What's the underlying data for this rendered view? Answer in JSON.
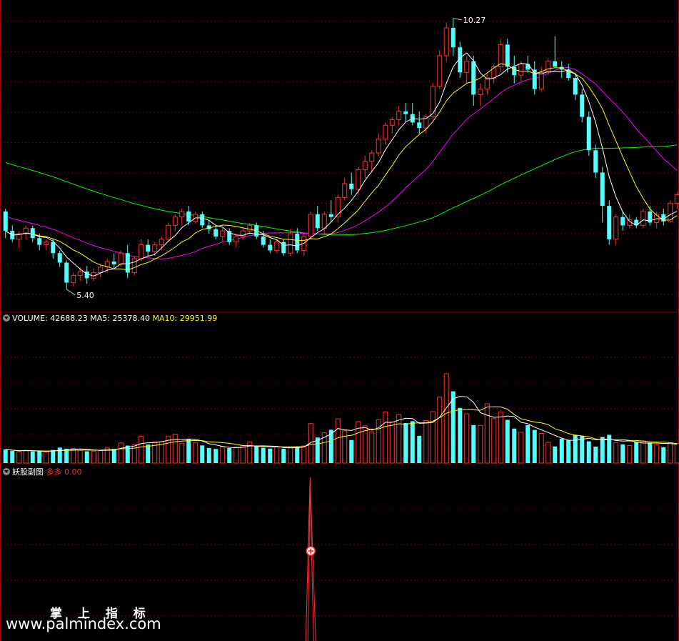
{
  "volume_header": {
    "name": "VOLUME:",
    "value": "42688.23",
    "ma5_label": "MA5:",
    "ma5_value": "25378.40",
    "ma10_label": "MA10:",
    "ma10_value": "29951.99"
  },
  "indicator_header": {
    "name": "妖股副图",
    "series_label": "多多",
    "series_value": "0.00"
  },
  "watermark": {
    "title": "掌 上 指 标",
    "url": "www.palmindex.com"
  },
  "colors": {
    "background": "#000000",
    "up": "#ff3232",
    "down": "#54ffff",
    "ma5": "#ffffff",
    "ma10": "#ffff00",
    "ma20": "#ff00ff",
    "ma60": "#00ff00",
    "grid": "#6e0000",
    "separator": "#a00000",
    "volume_header": "#ffffff",
    "volume_ma5": "#ffffff",
    "volume_ma10": "#ffff00",
    "indicator_label": "#ff3232"
  },
  "chart_data": [
    {
      "type": "candlestick",
      "panel": "price",
      "annotations": [
        {
          "text": "10.27",
          "kind": "high",
          "index": 66
        },
        {
          "text": "5.40",
          "kind": "low",
          "index": 9
        }
      ],
      "ylim": [
        5.0,
        10.55
      ],
      "moving_averages": [
        "MA5",
        "MA10",
        "MA20",
        "MA60"
      ],
      "candles": [
        [
          6.8,
          6.85,
          6.32,
          6.45
        ],
        [
          6.45,
          6.55,
          6.25,
          6.3
        ],
        [
          6.3,
          6.45,
          6.15,
          6.4
        ],
        [
          6.4,
          6.55,
          6.3,
          6.5
        ],
        [
          6.5,
          6.55,
          6.25,
          6.32
        ],
        [
          6.32,
          6.4,
          6.1,
          6.2
        ],
        [
          6.2,
          6.3,
          6.1,
          6.25
        ],
        [
          6.25,
          6.3,
          5.95,
          6.05
        ],
        [
          6.05,
          6.1,
          5.8,
          5.88
        ],
        [
          5.88,
          5.92,
          5.4,
          5.52
        ],
        [
          5.52,
          5.7,
          5.45,
          5.65
        ],
        [
          5.65,
          5.8,
          5.55,
          5.72
        ],
        [
          5.72,
          5.82,
          5.5,
          5.6
        ],
        [
          5.6,
          5.78,
          5.55,
          5.7
        ],
        [
          5.7,
          5.85,
          5.62,
          5.8
        ],
        [
          5.8,
          5.95,
          5.7,
          5.9
        ],
        [
          5.9,
          6.05,
          5.78,
          5.85
        ],
        [
          5.85,
          6.1,
          5.8,
          6.05
        ],
        [
          6.05,
          6.2,
          5.6,
          5.7
        ],
        [
          5.7,
          6.0,
          5.65,
          5.95
        ],
        [
          5.95,
          6.3,
          5.9,
          6.2
        ],
        [
          6.2,
          6.3,
          6.0,
          6.08
        ],
        [
          6.08,
          6.25,
          6.0,
          6.2
        ],
        [
          6.2,
          6.35,
          6.1,
          6.3
        ],
        [
          6.3,
          6.6,
          6.25,
          6.55
        ],
        [
          6.55,
          6.75,
          6.45,
          6.7
        ],
        [
          6.7,
          6.85,
          6.55,
          6.8
        ],
        [
          6.8,
          6.9,
          6.55,
          6.62
        ],
        [
          6.62,
          6.8,
          6.58,
          6.75
        ],
        [
          6.75,
          6.8,
          6.5,
          6.55
        ],
        [
          6.55,
          6.65,
          6.4,
          6.48
        ],
        [
          6.48,
          6.55,
          6.3,
          6.35
        ],
        [
          6.35,
          6.5,
          6.25,
          6.45
        ],
        [
          6.45,
          6.5,
          6.2,
          6.25
        ],
        [
          6.25,
          6.4,
          6.15,
          6.35
        ],
        [
          6.35,
          6.5,
          6.3,
          6.45
        ],
        [
          6.45,
          6.6,
          6.4,
          6.55
        ],
        [
          6.55,
          6.6,
          6.3,
          6.35
        ],
        [
          6.35,
          6.45,
          6.15,
          6.2
        ],
        [
          6.2,
          6.3,
          6.05,
          6.1
        ],
        [
          6.1,
          6.3,
          6.05,
          6.25
        ],
        [
          6.25,
          6.3,
          6.0,
          6.05
        ],
        [
          6.05,
          6.48,
          6.0,
          6.4
        ],
        [
          6.4,
          6.5,
          6.05,
          6.1
        ],
        [
          6.1,
          6.4,
          6.0,
          6.35
        ],
        [
          6.35,
          6.8,
          6.3,
          6.75
        ],
        [
          6.75,
          6.9,
          6.45,
          6.5
        ],
        [
          6.5,
          6.8,
          6.4,
          6.75
        ],
        [
          6.75,
          7.0,
          6.6,
          6.7
        ],
        [
          6.7,
          7.1,
          6.6,
          7.05
        ],
        [
          7.05,
          7.4,
          7.0,
          7.3
        ],
        [
          7.3,
          7.5,
          7.1,
          7.2
        ],
        [
          7.2,
          7.6,
          7.1,
          7.55
        ],
        [
          7.55,
          7.8,
          7.4,
          7.7
        ],
        [
          7.7,
          7.9,
          7.5,
          7.85
        ],
        [
          7.85,
          8.2,
          7.8,
          8.1
        ],
        [
          8.1,
          8.4,
          8.0,
          8.35
        ],
        [
          8.35,
          8.5,
          8.2,
          8.45
        ],
        [
          8.45,
          8.7,
          8.35,
          8.6
        ],
        [
          8.6,
          8.75,
          8.4,
          8.55
        ],
        [
          8.55,
          8.75,
          8.35,
          8.4
        ],
        [
          8.4,
          8.6,
          8.2,
          8.3
        ],
        [
          8.3,
          8.55,
          8.2,
          8.5
        ],
        [
          8.5,
          9.1,
          8.45,
          9.05
        ],
        [
          9.05,
          9.7,
          9.0,
          9.6
        ],
        [
          9.6,
          10.2,
          9.5,
          10.1
        ],
        [
          10.1,
          10.27,
          9.6,
          9.75
        ],
        [
          9.75,
          9.85,
          9.2,
          9.3
        ],
        [
          9.3,
          9.6,
          9.1,
          9.5
        ],
        [
          9.5,
          9.6,
          8.7,
          8.9
        ],
        [
          8.9,
          9.1,
          8.7,
          9.0
        ],
        [
          9.0,
          9.3,
          8.9,
          9.2
        ],
        [
          9.2,
          9.45,
          9.1,
          9.4
        ],
        [
          9.4,
          9.9,
          9.3,
          9.8
        ],
        [
          9.8,
          9.9,
          9.3,
          9.4
        ],
        [
          9.4,
          9.6,
          9.1,
          9.25
        ],
        [
          9.25,
          9.5,
          9.15,
          9.45
        ],
        [
          9.45,
          9.6,
          9.3,
          9.35
        ],
        [
          9.35,
          9.5,
          8.9,
          9.0
        ],
        [
          9.0,
          9.4,
          8.95,
          9.3
        ],
        [
          9.3,
          9.55,
          9.25,
          9.5
        ],
        [
          9.5,
          9.95,
          9.4,
          9.4
        ],
        [
          9.4,
          9.5,
          9.2,
          9.35
        ],
        [
          9.35,
          9.45,
          9.15,
          9.2
        ],
        [
          9.2,
          9.3,
          8.8,
          8.9
        ],
        [
          8.9,
          9.0,
          8.4,
          8.5
        ],
        [
          8.5,
          8.6,
          7.8,
          7.9
        ],
        [
          7.9,
          8.0,
          7.4,
          7.5
        ],
        [
          7.5,
          7.6,
          6.6,
          6.9
        ],
        [
          6.9,
          7.0,
          6.2,
          6.3
        ],
        [
          6.3,
          6.75,
          6.2,
          6.7
        ],
        [
          6.7,
          6.8,
          6.45,
          6.55
        ],
        [
          6.55,
          6.75,
          6.5,
          6.65
        ],
        [
          6.65,
          6.7,
          6.5,
          6.55
        ],
        [
          6.55,
          6.85,
          6.5,
          6.8
        ],
        [
          6.8,
          6.9,
          6.55,
          6.6
        ],
        [
          6.6,
          6.8,
          6.5,
          6.75
        ],
        [
          6.75,
          6.85,
          6.55,
          6.62
        ],
        [
          6.62,
          7.0,
          6.6,
          6.95
        ],
        [
          6.95,
          7.15,
          6.85,
          7.1
        ]
      ]
    },
    {
      "type": "bar",
      "panel": "volume",
      "series_name": "VOLUME",
      "ylim": [
        0,
        85000
      ],
      "values": [
        8100,
        7200,
        6800,
        7600,
        6900,
        7000,
        6600,
        7800,
        9200,
        8500,
        8800,
        7600,
        7000,
        7100,
        7400,
        9000,
        8400,
        12000,
        10400,
        11000,
        16000,
        11000,
        12500,
        12800,
        15800,
        17200,
        11800,
        14000,
        12000,
        10500,
        9000,
        8400,
        9700,
        8900,
        9500,
        10200,
        12500,
        10000,
        9100,
        8600,
        9800,
        8500,
        9300,
        9700,
        10200,
        23500,
        15200,
        18000,
        19800,
        26300,
        19200,
        13700,
        24600,
        22100,
        18500,
        25800,
        30400,
        24400,
        28900,
        23800,
        24900,
        16200,
        25300,
        30600,
        39200,
        53100,
        42688,
        32800,
        29300,
        22600,
        22400,
        35300,
        26400,
        30300,
        25700,
        20500,
        18300,
        22600,
        19700,
        17700,
        12400,
        9900,
        14500,
        13600,
        16800,
        16100,
        12900,
        9800,
        15500,
        16800,
        12200,
        11100,
        10400,
        12700,
        13200,
        12200,
        10900,
        9400,
        12100,
        11600
      ]
    },
    {
      "type": "line",
      "panel": "indicator",
      "series_name": "多多",
      "ylim": [
        0,
        100
      ],
      "signal_index": 45,
      "peak_value": 100,
      "marker_value": 55,
      "last_value": 0.0
    }
  ]
}
